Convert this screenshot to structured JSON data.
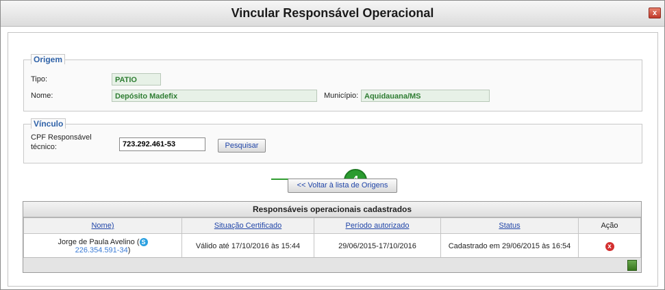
{
  "dialog": {
    "title": "Vincular Responsável Operacional",
    "close_glyph": "x"
  },
  "origem": {
    "legend": "Origem",
    "tipo_label": "Tipo:",
    "tipo_value": "PATIO",
    "nome_label": "Nome:",
    "nome_value": "Depósito Madefix",
    "municipio_label": "Município:",
    "municipio_value": "Aquidauana/MS"
  },
  "vinculo": {
    "legend": "Vínculo",
    "cpf_label_line1": "CPF Responsável",
    "cpf_label_line2": "técnico:",
    "cpf_value": "723.292.461-53",
    "search_button": "Pesquisar"
  },
  "callout": {
    "number": "4"
  },
  "back_button": "<< Voltar à lista de Origens",
  "table": {
    "caption": "Responsáveis operacionais cadastrados",
    "columns": [
      "Nome)",
      "Situação Certificado",
      "Período autorizado",
      "Status",
      "Ação"
    ],
    "rows": [
      {
        "nome": "Jorge de Paula Avelino (",
        "cpf": "226.354.591-34",
        "cpf_suffix": ")",
        "situacao": "Válido até 17/10/2016 às 15:44",
        "periodo": "29/06/2015-17/10/2016",
        "status": "Cadastrado em 29/06/2015 às 16:54",
        "acao_glyph": "x"
      }
    ]
  },
  "icons": {
    "close": "close-icon",
    "skype": "skype-icon",
    "remove": "remove-icon",
    "export": "export-icon"
  }
}
